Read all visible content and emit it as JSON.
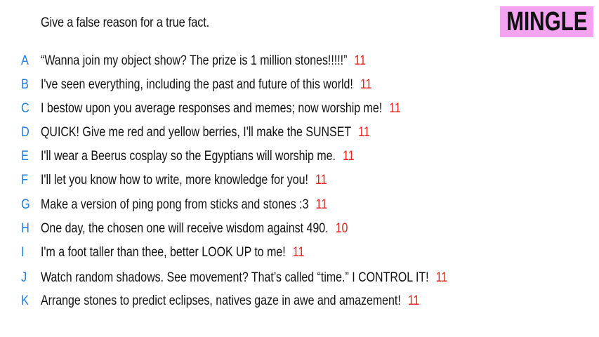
{
  "prompt": "Give a false reason for a true fact.",
  "logo": "MINGLE",
  "colors": {
    "letter": "#1f7ee0",
    "score": "#e8221c",
    "logo_bg": "#f4a3f0"
  },
  "answers": [
    {
      "letter": "A",
      "text": "“Wanna join my object show? The prize is 1 million stones!!!!!”",
      "score": "11"
    },
    {
      "letter": "B",
      "text": "I've seen everything, including the past and future of this world!",
      "score": "11"
    },
    {
      "letter": "C",
      "text": "I bestow upon you average responses and memes; now worship me!",
      "score": "11"
    },
    {
      "letter": "D",
      "text": "QUICK! Give me red and yellow berries, I'll make the SUNSET",
      "score": "11"
    },
    {
      "letter": "E",
      "text": "I'll wear a Beerus cosplay so the Egyptians will worship me.",
      "score": "11"
    },
    {
      "letter": "F",
      "text": "I'll let you know how to write, more knowledge for you!",
      "score": "11"
    },
    {
      "letter": "G",
      "text": "Make a version of ping pong from sticks and stones :3",
      "score": "11"
    },
    {
      "letter": "H",
      "text": "One day, the chosen one will receive wisdom against 490.",
      "score": "10"
    },
    {
      "letter": "I",
      "text": "I'm a foot taller than thee, better LOOK UP to me!",
      "score": "11"
    },
    {
      "letter": "J",
      "text": "Watch random shadows. See movement? That’s called “time.” I CONTROL IT!",
      "score": "11"
    },
    {
      "letter": "K",
      "text": "Arrange stones to predict eclipses, natives gaze in awe and amazement!",
      "score": "11"
    }
  ]
}
